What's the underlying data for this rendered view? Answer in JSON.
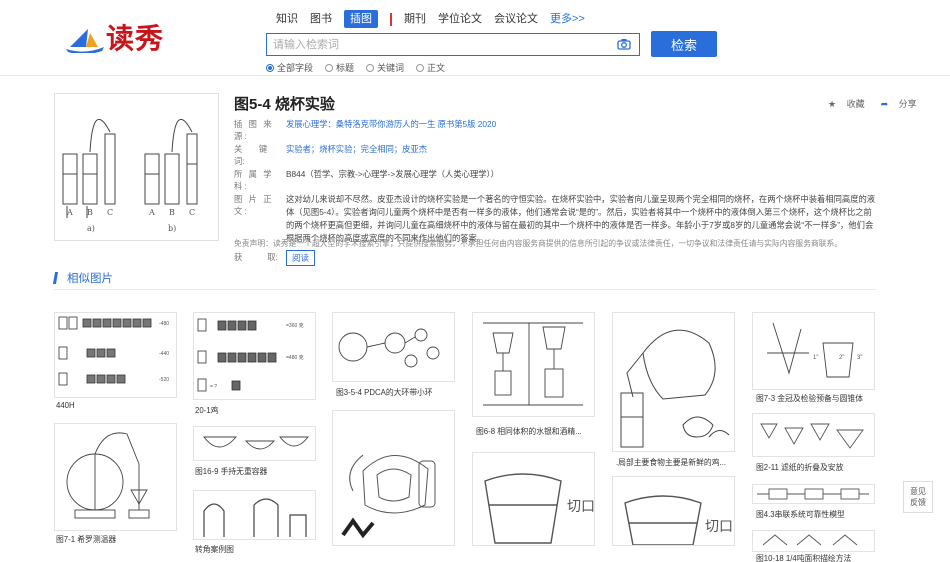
{
  "logo": {
    "text": "读秀"
  },
  "channels": [
    "知识",
    "图书",
    "插图",
    "期刊",
    "学位论文",
    "会议论文",
    "更多>>"
  ],
  "active_channel": "插图",
  "search": {
    "placeholder": "请输入检索词",
    "button": "检索"
  },
  "scope": [
    "全部字段",
    "标题",
    "关键词",
    "正文"
  ],
  "detail": {
    "title": "图5-4 烧杯实验",
    "collect": "收藏",
    "share": "分享",
    "fields": {
      "source_label": "插 图 来 源:",
      "source": "发展心理学：桑特洛克带你游历人的一生 原书第5版 2020",
      "keywords_label": "关　　键　　词:",
      "keywords": "实验者；烧杯实验；完全相同；皮亚杰",
      "discipline_label": "所 属 学 科:",
      "discipline": "B844（哲学、宗教->心理学->发展心理学（人类心理学））",
      "text_label": "图 片 正 文:",
      "text": "这对幼儿来说却不尽然。皮亚杰设计的烧杯实验是一个著名的守恒实验。在烧杯实验中，实验者向儿童呈现两个完全相同的烧杯，在两个烧杯中装着相同高度的液体（见图5-4）。实验者询问儿童两个烧杯中是否有一样多的液体，他们通常会说“是的”。然后，实验者将其中一个烧杯中的液体倒入第三个烧杯，这个烧杯比之前的两个烧杯更高但更细，并询问儿童在高细烧杯中的液体与留在最初的其中一个烧杯中的液体是否一样多。年龄小于7岁或8岁的儿童通常会说“不一样多”，他们会根据两个烧杯的高度或宽度的不同来作出他们的答案。",
      "get_label": "获　　　取:",
      "read_button": "阅读"
    },
    "disclaimer": "免责声明：读秀是一个超大型的学术搜索引擎，只提供搜索服务，不承担任何由内容服务商提供的信息所引起的争议或法律责任，一切争议和法律责任请与实际内容服务商联系。",
    "image_labels": [
      "A",
      "B",
      "C",
      "A",
      "B",
      "C",
      "a)",
      "b)"
    ]
  },
  "similar": {
    "title": "相似图片",
    "items": [
      {
        "caption": "440H",
        "inner": [
          "-480",
          "-440",
          "-520"
        ]
      },
      {
        "caption": "20-1鸡",
        "inner": [
          "=360 克",
          "=480 克",
          "= ?"
        ]
      },
      {
        "caption": "图3-5-4 PDCA的大环带小环"
      },
      {
        "caption": "图6-8 相同体积的水银和酒精..."
      },
      {
        "caption": ".局部主要食物主要是新鲜的鸡..."
      },
      {
        "caption": "图7-3 金冠及检验预备与圆锥体",
        "inner": [
          "1\"",
          "2\"",
          "3\""
        ]
      },
      {
        "caption": "图7-1 希罗测温器"
      },
      {
        "caption": "图16-9 手持无重容器"
      },
      {
        "caption": "转角案例图"
      },
      {
        "caption": "图2-11 滤纸的折叠及安放"
      },
      {
        "caption": "图4.3串联系统可靠性模型"
      },
      {
        "caption": "图10-18 1/4吨面积描绘方法"
      },
      {
        "inner": [
          "切口"
        ]
      },
      {
        "inner": [
          "切口"
        ]
      }
    ]
  },
  "feedback": {
    "line1": "意见",
    "line2": "反馈"
  },
  "colors": {
    "accent": "#2a6edb",
    "brand": "#c8141a"
  }
}
